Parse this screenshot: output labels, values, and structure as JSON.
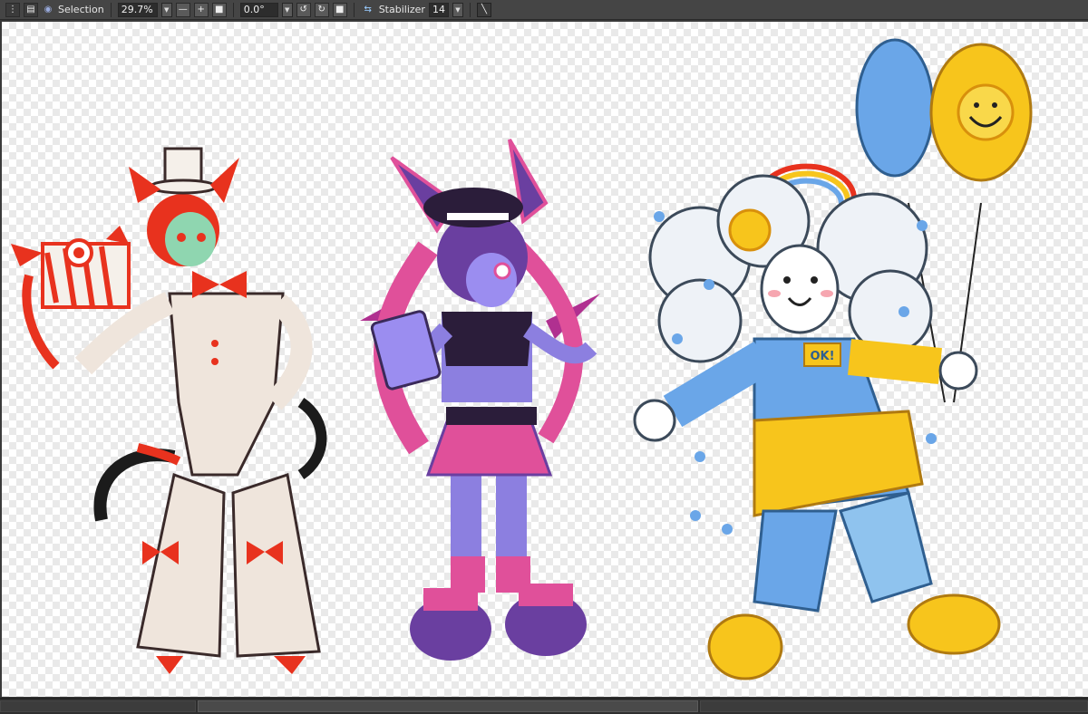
{
  "toolbar": {
    "selection_label": "Selection",
    "zoom_value": "29.7%",
    "rotation_value": "0.0°",
    "stabilizer_label": "Stabilizer",
    "stabilizer_value": "14"
  },
  "canvas": {
    "artwork": [
      {
        "character": "red-white-cat-clown"
      },
      {
        "character": "purple-pink-bat-punk"
      },
      {
        "character": "cloud-rainbow-sun-clown",
        "badge_text": "OK!"
      }
    ]
  },
  "colors": {
    "toolbar_bg": "#454545",
    "canvas_bg": "#ffffff",
    "red": "#e8321e",
    "purple": "#6a3fa0",
    "pink": "#e0509a",
    "blue": "#6aa6e8",
    "yellow": "#f7c51c"
  },
  "icons": [
    "menu-icon",
    "stack-icon",
    "eye-icon",
    "zoom-out-icon",
    "zoom-in-icon",
    "fit-icon",
    "rotate-left-icon",
    "rotate-right-icon",
    "reset-rotation-icon",
    "flip-icon",
    "pen-icon"
  ]
}
